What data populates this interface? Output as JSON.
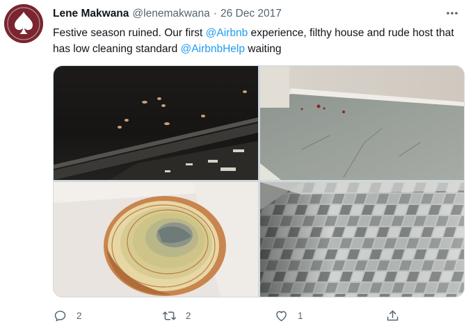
{
  "tweet": {
    "author_name": "Lene Makwana",
    "handle": "@lenemakwana",
    "separator": "·",
    "date": "26 Dec 2017",
    "text_parts": {
      "p1": "Festive season ruined. Our first ",
      "m1": "@Airbnb",
      "p2": " experience, filthy house and rude host that has low cleaning standard ",
      "m2": "@AirbnbHelp",
      "p3": " waiting"
    },
    "images": [
      {
        "icon": "oven-tray-photo"
      },
      {
        "icon": "dirty-floor-photo"
      },
      {
        "icon": "rotten-onion-photo"
      },
      {
        "icon": "tiled-floor-photo"
      }
    ],
    "actions": {
      "reply_count": "2",
      "retweet_count": "2",
      "like_count": "1"
    }
  },
  "colors": {
    "accent": "#1d9bf0",
    "text": "#0f1419",
    "muted": "#536471",
    "avatar": "#7a2530"
  }
}
